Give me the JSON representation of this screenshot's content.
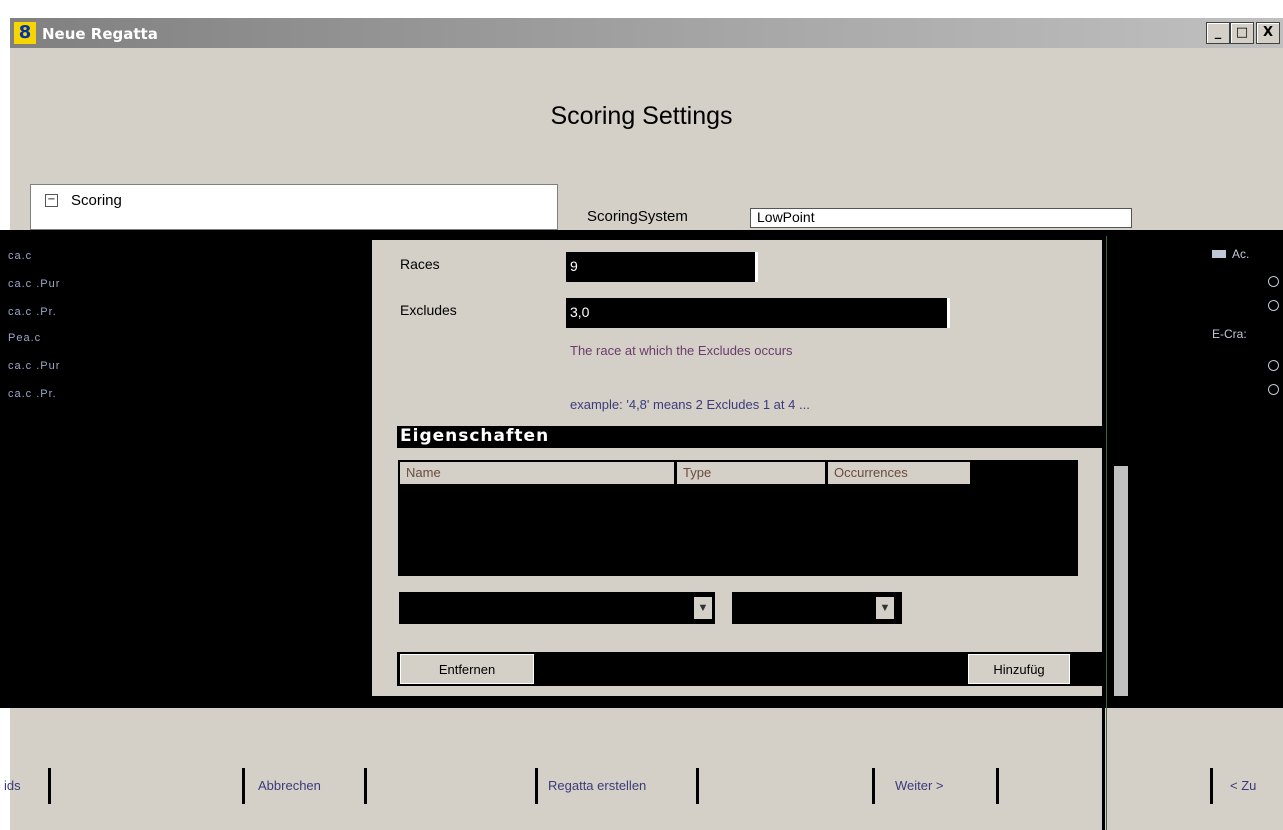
{
  "window": {
    "title": "Neue Regatta",
    "app_icon_text": "8",
    "controls": {
      "minimize": "_",
      "maximize": "□",
      "close": "X"
    }
  },
  "heading": "Scoring Settings",
  "tree": {
    "expander": "−",
    "root_label": "Scoring"
  },
  "scoring": {
    "label": "ScoringSystem",
    "value": "LowPoint"
  },
  "left_panel": {
    "items": [
      "ca.c",
      "ca.c .Pur",
      "ca.c .Pr.",
      "Pea.c",
      "ca.c .Pur",
      "ca.c .Pr."
    ]
  },
  "form": {
    "races_label": "Races",
    "races_value": "9",
    "excludes_label": "Excludes",
    "excludes_value": "3,0",
    "hint_1": "The race at which the Excludes occurs",
    "hint_2": "example: '4,8' means 2 Excludes 1 at 4 ..."
  },
  "properties": {
    "title": "Eigenschaften",
    "columns": [
      "Name",
      "Type",
      "Occurrences"
    ],
    "rows": []
  },
  "buttons": {
    "remove": "Entfernen",
    "add": "Hinzufüg"
  },
  "right_panel": {
    "items": [
      "Ac.",
      "C",
      "C",
      "E-Cra:",
      "C",
      "C"
    ]
  },
  "nav": {
    "back": "< Zurück",
    "cancel": "Abbrechen",
    "create": "Regatta erstellen",
    "next": "Weiter >",
    "left_partial": "ids",
    "right_partial": "< Zu"
  },
  "colors": {
    "window_bg": "#d4d0c8",
    "titlebar": "#808080",
    "app_icon": "#f7d500"
  }
}
